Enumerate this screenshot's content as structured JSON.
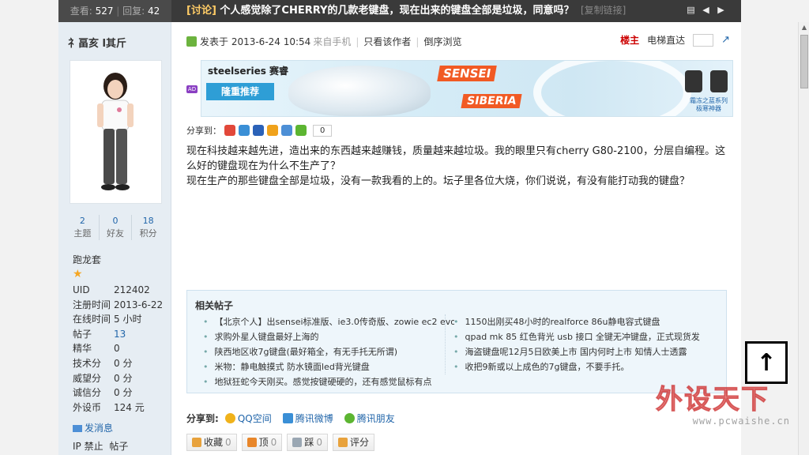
{
  "topbar": {
    "views_label": "查看:",
    "views": "527",
    "replies_label": "回复:",
    "replies": "42",
    "tag": "[讨论]",
    "title": "个人感觉除了CHERRY的几款老键盘，现在出来的键盘全部是垃圾，同意吗？",
    "copy_link": "[复制链接]"
  },
  "user": {
    "name": "礻畐亥  l其斤",
    "stats": [
      {
        "num": "2",
        "label": "主题"
      },
      {
        "num": "0",
        "label": "好友"
      },
      {
        "num": "18",
        "label": "积分"
      }
    ],
    "rank": "跑龙套",
    "info": [
      {
        "k": "UID",
        "v": "212402"
      },
      {
        "k": "注册时间",
        "v": "2013-6-22"
      },
      {
        "k": "在线时间",
        "v": "5 小时"
      },
      {
        "k": "帖子",
        "v": "13"
      },
      {
        "k": "精华",
        "v": "0"
      },
      {
        "k": "技术分",
        "v": "0 分"
      },
      {
        "k": "威望分",
        "v": "0 分"
      },
      {
        "k": "诚信分",
        "v": "0 分"
      },
      {
        "k": "外设币",
        "v": "124 元"
      }
    ],
    "pm": "发消息",
    "ip_ban": "IP 禁止",
    "posts": "帖子"
  },
  "post": {
    "posted_at": "发表于 2013-6-24 10:54",
    "source": "来自手机",
    "only_author": "只看该作者",
    "reverse": "倒序浏览",
    "floor": "楼主",
    "elevator": "电梯直达",
    "share_label": "分享到：",
    "share_count": "0",
    "body": [
      "现在科技越来越先进，造出来的东西越来越赚钱，质量越来越垃圾。我的眼里只有cherry G80-2100，分层自编程。这么好的键盘现在为什么不生产了？",
      "现在生产的那些键盘全部是垃圾，没有一款我看的上的。坛子里各位大烧，你们说说，有没有能打动我的键盘？"
    ]
  },
  "banner": {
    "brand": "steelseries 赛睿",
    "recommend": "隆重推荐",
    "sensei": "SENSEI",
    "siberia": "SIBERIA",
    "caption1": "霜冻之蓝系列",
    "caption2": "极寒神器"
  },
  "related": {
    "title": "相关帖子",
    "left": [
      "【北京个人】出sensei标准版、ie3.0传奇版、zowie ec2 evo",
      "求购外星人键盘最好上海的",
      "陕西地区收7g键盘(最好箱全，有无手托无所谓)",
      "米物：静电触摸式 防水镜面led背光键盘",
      "地狱狂蛇今天刚买。感觉按键硬硬的，还有感觉鼠标有点"
    ],
    "right": [
      "1150出刚买48小时的realforce 86u静电容式键盘",
      "qpad mk 85 红色背光 usb 接口 全键无冲键盘，正式现货发",
      "海盗键盘呢12月5日欧美上市 国内何时上市 知情人士透露",
      "收把9新或以上成色的7g键盘，不要手托。"
    ]
  },
  "shareto": {
    "label": "分享到:",
    "items": [
      "QQ空间",
      "腾讯微博",
      "腾讯朋友"
    ]
  },
  "actions": [
    {
      "label": "收藏",
      "count": "0"
    },
    {
      "label": "顶",
      "count": "0"
    },
    {
      "label": "踩",
      "count": "0"
    },
    {
      "label": "评分",
      "count": ""
    }
  ],
  "watermark": {
    "big": "外设天下",
    "url": "www.pcwaishe.cn"
  },
  "colors": {
    "accent": "#2266aa",
    "floor": "#cc0000",
    "topbar": "#3a3a3a"
  }
}
